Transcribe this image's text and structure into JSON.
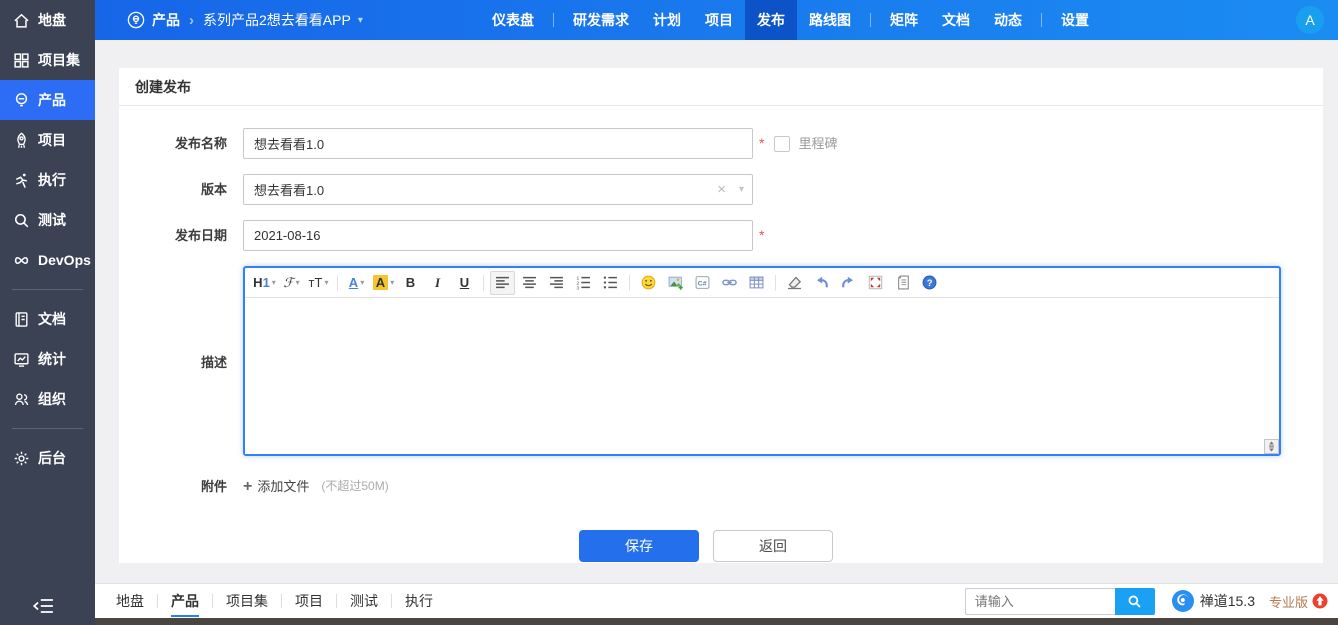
{
  "colors": {
    "topbar_gradient_start": "#1766e8",
    "topbar_gradient_end": "#1b8cf2",
    "topbar_active": "#0b53c6",
    "sidebar_bg": "#3b4254",
    "sidebar_active": "#2d6df6",
    "accent_blue": "#2470ec",
    "search_button_blue": "#1ba1f3",
    "avatar_blue": "#18a0ee",
    "required_red": "#e5534b",
    "edition_brown": "#b57b52",
    "badge_red": "#e8432e",
    "editor_focus_border": "#3180f6"
  },
  "sidebar": {
    "items": [
      {
        "label": "地盘",
        "icon": "home-icon",
        "active": false,
        "divider_after": false
      },
      {
        "label": "项目集",
        "icon": "program-icon",
        "active": false,
        "divider_after": false
      },
      {
        "label": "产品",
        "icon": "product-icon",
        "active": true,
        "divider_after": false
      },
      {
        "label": "项目",
        "icon": "project-icon",
        "active": false,
        "divider_after": false
      },
      {
        "label": "执行",
        "icon": "execution-icon",
        "active": false,
        "divider_after": false
      },
      {
        "label": "测试",
        "icon": "qa-icon",
        "active": false,
        "divider_after": false
      },
      {
        "label": "DevOps",
        "icon": "devops-icon",
        "active": false,
        "divider_after": true
      },
      {
        "label": "文档",
        "icon": "doc-icon",
        "active": false,
        "divider_after": false
      },
      {
        "label": "统计",
        "icon": "report-icon",
        "active": false,
        "divider_after": false
      },
      {
        "label": "组织",
        "icon": "org-icon",
        "active": false,
        "divider_after": true
      },
      {
        "label": "后台",
        "icon": "admin-icon",
        "active": false,
        "divider_after": false
      }
    ]
  },
  "topbar": {
    "breadcrumb": {
      "module": "产品",
      "separator": "›",
      "entry": "系列产品2想去看看APP",
      "caret": "▾"
    },
    "nav": [
      {
        "label": "仪表盘",
        "active": false,
        "divider_after": true
      },
      {
        "label": "研发需求",
        "active": false,
        "divider_after": false
      },
      {
        "label": "计划",
        "active": false,
        "divider_after": false
      },
      {
        "label": "项目",
        "active": false,
        "divider_after": false
      },
      {
        "label": "发布",
        "active": true,
        "divider_after": false
      },
      {
        "label": "路线图",
        "active": false,
        "divider_after": true
      },
      {
        "label": "矩阵",
        "active": false,
        "divider_after": false
      },
      {
        "label": "文档",
        "active": false,
        "divider_after": false
      },
      {
        "label": "动态",
        "active": false,
        "divider_after": true
      },
      {
        "label": "设置",
        "active": false,
        "divider_after": false
      }
    ],
    "avatar_initial": "A"
  },
  "form": {
    "title": "创建发布",
    "required_mark": "*",
    "name_label": "发布名称",
    "name_value": "想去看看1.0",
    "milestone_label": "里程碑",
    "build_label": "版本",
    "build_value": "想去看看1.0",
    "build_clear": "×",
    "build_caret": "▾",
    "date_label": "发布日期",
    "date_value": "2021-08-16",
    "desc_label": "描述",
    "attach_label": "附件",
    "attach_plus": "+",
    "attach_add_label": "添加文件",
    "attach_hint": "(不超过50M)",
    "save_label": "保存",
    "back_label": "返回"
  },
  "editor": {
    "toolbar": [
      {
        "name": "heading",
        "type": "text",
        "glyph": "H",
        "glyph2": "1",
        "caret": true,
        "style": "g-bold"
      },
      {
        "name": "font-family",
        "type": "text",
        "glyph": "ℱ",
        "caret": true,
        "style": "g-italic"
      },
      {
        "name": "font-size",
        "type": "text",
        "glyph": "тT",
        "caret": true,
        "sep_after": true
      },
      {
        "name": "font-color",
        "type": "text",
        "glyph": "A",
        "caret": true,
        "style": "g-blue g-bold g-und"
      },
      {
        "name": "highlight-color",
        "type": "text",
        "glyph": "A",
        "caret": true,
        "style": "g-hl g-bold"
      },
      {
        "name": "bold",
        "type": "text",
        "glyph": "B",
        "style": "g-bold"
      },
      {
        "name": "italic",
        "type": "text",
        "glyph": "I",
        "style": "g-italic g-bold"
      },
      {
        "name": "underline",
        "type": "text",
        "glyph": "U",
        "style": "g-und g-bold",
        "sep_after": true
      },
      {
        "name": "align-left",
        "type": "svg",
        "boxed": true
      },
      {
        "name": "align-center",
        "type": "svg"
      },
      {
        "name": "align-right",
        "type": "svg"
      },
      {
        "name": "ordered-list",
        "type": "svg"
      },
      {
        "name": "unordered-list",
        "type": "svg",
        "sep_after": true
      },
      {
        "name": "emoticon",
        "type": "svg"
      },
      {
        "name": "image",
        "type": "svg"
      },
      {
        "name": "code",
        "type": "svg"
      },
      {
        "name": "link",
        "type": "svg"
      },
      {
        "name": "table",
        "type": "svg",
        "sep_after": true
      },
      {
        "name": "remove-format",
        "type": "svg"
      },
      {
        "name": "undo",
        "type": "svg"
      },
      {
        "name": "redo",
        "type": "svg"
      },
      {
        "name": "fullscreen",
        "type": "svg"
      },
      {
        "name": "source",
        "type": "svg"
      },
      {
        "name": "about",
        "type": "svg"
      }
    ]
  },
  "footer": {
    "tabs": [
      {
        "label": "地盘",
        "active": false
      },
      {
        "label": "产品",
        "active": true
      },
      {
        "label": "项目集",
        "active": false
      },
      {
        "label": "项目",
        "active": false
      },
      {
        "label": "测试",
        "active": false
      },
      {
        "label": "执行",
        "active": false
      }
    ],
    "search_placeholder": "请输入",
    "brand_name": "禅道15.3",
    "edition_label": "专业版"
  }
}
